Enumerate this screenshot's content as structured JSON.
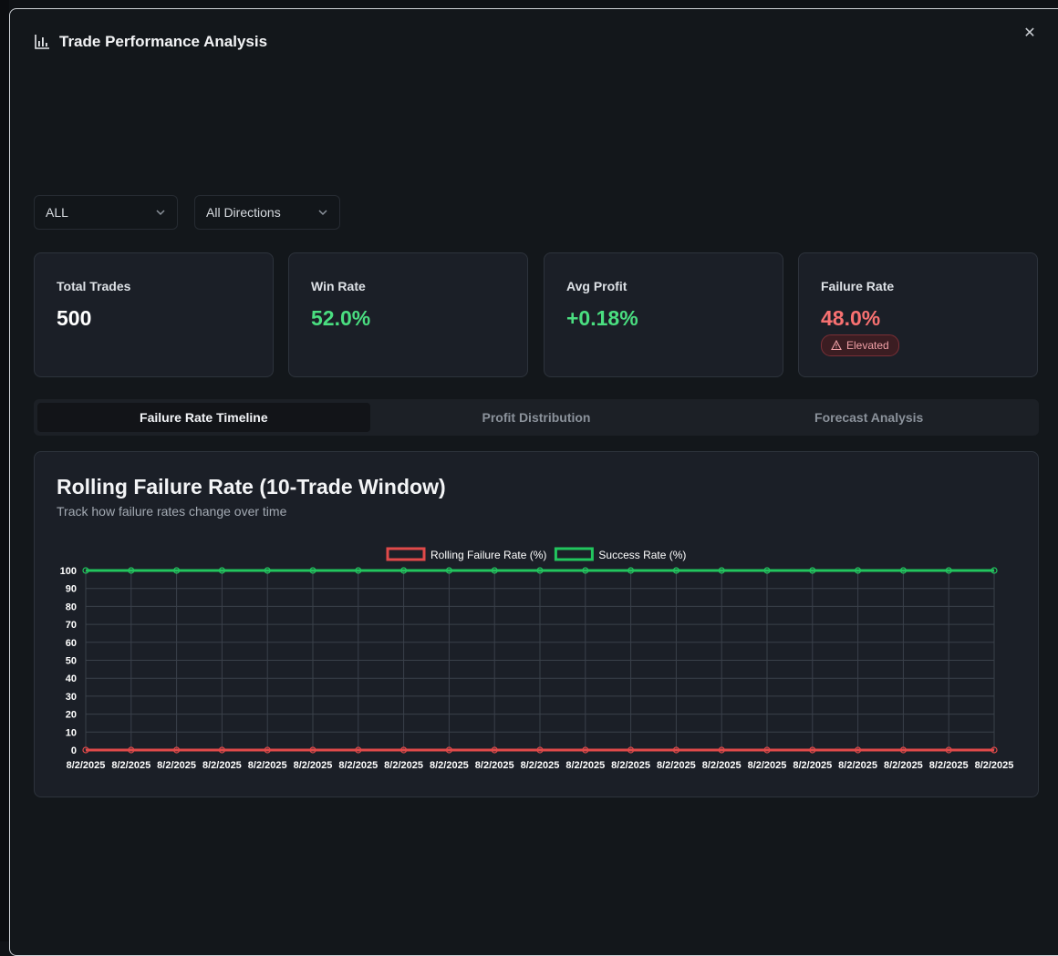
{
  "modal": {
    "title": "Trade Performance Analysis",
    "title_icon": "bar-chart-icon",
    "close_icon": "close-icon",
    "close_glyph": "✕"
  },
  "filters": {
    "symbol": {
      "value": "ALL",
      "icon": "chevron-down-icon"
    },
    "direction": {
      "value": "All Directions",
      "icon": "chevron-down-icon"
    }
  },
  "stats": [
    {
      "label": "Total Trades",
      "value": "500",
      "color": "#ffffff"
    },
    {
      "label": "Win Rate",
      "value": "52.0%",
      "color": "#4ade80"
    },
    {
      "label": "Avg Profit",
      "value": "+0.18%",
      "color": "#4ade80"
    },
    {
      "label": "Failure Rate",
      "value": "48.0%",
      "color": "#f87171",
      "badge": {
        "label": "Elevated",
        "icon": "alert-triangle-icon"
      }
    }
  ],
  "tabs": [
    {
      "label": "Failure Rate Timeline",
      "active": true
    },
    {
      "label": "Profit Distribution",
      "active": false
    },
    {
      "label": "Forecast Analysis",
      "active": false
    }
  ],
  "chart_card": {
    "title": "Rolling Failure Rate (10-Trade Window)",
    "subtitle": "Track how failure rates change over time"
  },
  "chart_data": {
    "type": "line",
    "x": [
      "8/2/2025",
      "8/2/2025",
      "8/2/2025",
      "8/2/2025",
      "8/2/2025",
      "8/2/2025",
      "8/2/2025",
      "8/2/2025",
      "8/2/2025",
      "8/2/2025",
      "8/2/2025",
      "8/2/2025",
      "8/2/2025",
      "8/2/2025",
      "8/2/2025",
      "8/2/2025",
      "8/2/2025",
      "8/2/2025",
      "8/2/2025",
      "8/2/2025",
      "8/2/2025"
    ],
    "series": [
      {
        "name": "Rolling Failure Rate (%)",
        "color": "#e04a4a",
        "values": [
          0,
          0,
          0,
          0,
          0,
          0,
          0,
          0,
          0,
          0,
          0,
          0,
          0,
          0,
          0,
          0,
          0,
          0,
          0,
          0,
          0
        ]
      },
      {
        "name": "Success Rate (%)",
        "color": "#22c55e",
        "values": [
          100,
          100,
          100,
          100,
          100,
          100,
          100,
          100,
          100,
          100,
          100,
          100,
          100,
          100,
          100,
          100,
          100,
          100,
          100,
          100,
          100
        ]
      }
    ],
    "y_ticks": [
      0,
      10,
      20,
      30,
      40,
      50,
      60,
      70,
      80,
      90,
      100
    ],
    "ylim": [
      0,
      100
    ],
    "grid": true,
    "legend_position": "top-center"
  }
}
